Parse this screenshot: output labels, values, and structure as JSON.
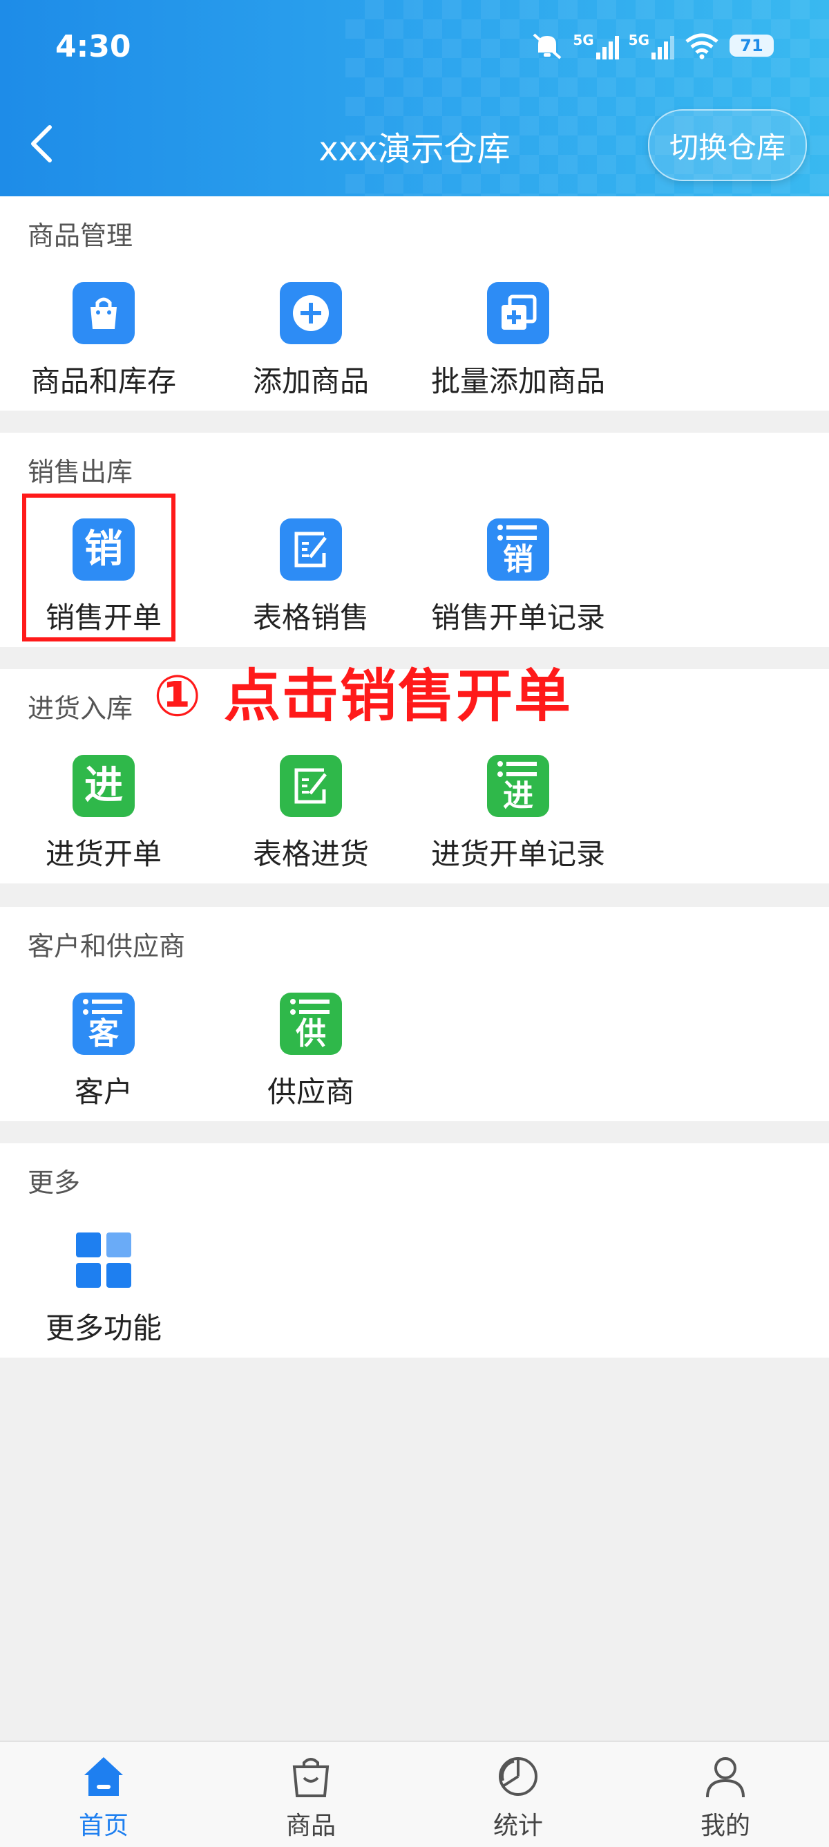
{
  "status_bar": {
    "time": "4:30",
    "signal_label_1": "5G",
    "signal_label_2": "5G",
    "battery": "71"
  },
  "header": {
    "title": "xxx演示仓库",
    "switch_button": "切换仓库"
  },
  "sections": {
    "goods": {
      "title": "商品管理",
      "items": [
        "商品和库存",
        "添加商品",
        "批量添加商品"
      ]
    },
    "sales": {
      "title": "销售出库",
      "items": [
        "销售开单",
        "表格销售",
        "销售开单记录"
      ],
      "icon_chars": [
        "销",
        "销"
      ]
    },
    "purchase": {
      "title": "进货入库",
      "items": [
        "进货开单",
        "表格进货",
        "进货开单记录"
      ],
      "icon_chars": [
        "进",
        "进"
      ]
    },
    "partners": {
      "title": "客户和供应商",
      "items": [
        "客户",
        "供应商"
      ],
      "icon_chars": [
        "客",
        "供"
      ]
    },
    "more": {
      "title": "更多",
      "items": [
        "更多功能"
      ]
    }
  },
  "annotation": {
    "text": "① 点击销售开单",
    "color": "#ff1a1a"
  },
  "bottom_nav": {
    "items": [
      "首页",
      "商品",
      "统计",
      "我的"
    ],
    "active": "首页"
  },
  "colors": {
    "accent": "#1e8ce8",
    "icon_blue": "#2d8cf5",
    "icon_green": "#2fb84a"
  }
}
